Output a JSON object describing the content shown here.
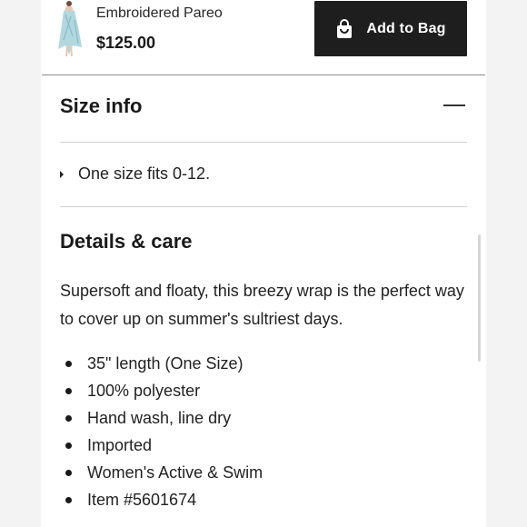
{
  "product": {
    "name": "Embroidered Pareo",
    "price": "$125.00",
    "add_to_bag_label": "Add to Bag",
    "thumbnail_icon": "product-thumbnail"
  },
  "size_info": {
    "title": "Size info",
    "toggle_icon": "minus-icon",
    "items": [
      "One size fits 0-12."
    ]
  },
  "details": {
    "title": "Details & care",
    "description": "Supersoft and floaty, this breezy wrap is the perfect way to cover up on summer's sultriest days.",
    "items": [
      "35\" length (One Size)",
      "100% polyester",
      "Hand wash, line dry",
      "Imported",
      "Women's Active & Swim",
      "Item #5601674"
    ]
  },
  "colors": {
    "button_bg": "#1e1e1e",
    "button_text": "#ffffff",
    "thumbnail_fabric": "#a9d3dc"
  }
}
